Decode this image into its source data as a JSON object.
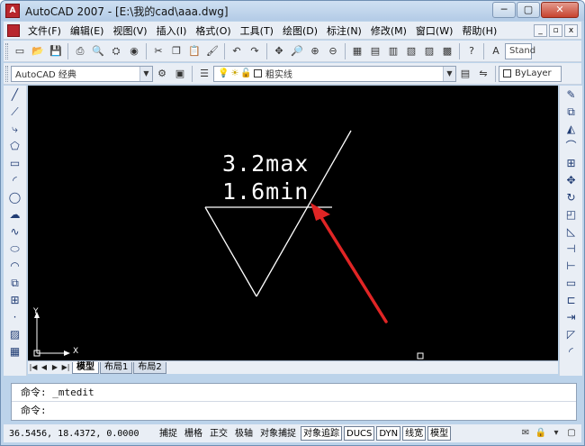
{
  "window": {
    "title": "AutoCAD 2007 - [E:\\我的cad\\aaa.dwg]",
    "minimize": "─",
    "restore": "▢",
    "close": "✕"
  },
  "menubar": {
    "items": [
      "文件(F)",
      "编辑(E)",
      "视图(V)",
      "插入(I)",
      "格式(O)",
      "工具(T)",
      "绘图(D)",
      "标注(N)",
      "修改(M)",
      "窗口(W)",
      "帮助(H)"
    ],
    "doc_min": "_",
    "doc_restore": "▫",
    "doc_close": "x"
  },
  "toolbar1": {
    "standard_label": "Stand"
  },
  "toolbar2": {
    "workspace": "AutoCAD 经典",
    "layer": "粗实线",
    "color": "ByLayer"
  },
  "drawing": {
    "dim_text_1": "3.2max",
    "dim_text_2": "1.6min",
    "ucs_y": "Y",
    "ucs_x": "X"
  },
  "layout_tabs": {
    "nav": [
      "|◀",
      "◀",
      "▶",
      "▶|"
    ],
    "tabs": [
      "模型",
      "布局1",
      "布局2"
    ]
  },
  "command": {
    "line1": "命令: _mtedit",
    "line2": "命令:"
  },
  "status": {
    "coords": "36.5456, 18.4372, 0.0000",
    "buttons": [
      "捕捉",
      "栅格",
      "正交",
      "极轴",
      "对象捕捉",
      "对象追踪",
      "DUCS",
      "DYN",
      "线宽",
      "模型"
    ],
    "active_buttons": [
      "对象追踪",
      "DUCS",
      "DYN",
      "线宽",
      "模型"
    ]
  },
  "colors": {
    "canvas_bg": "#000000",
    "arrow": "#e02525",
    "drawing_line": "#ffffff"
  }
}
